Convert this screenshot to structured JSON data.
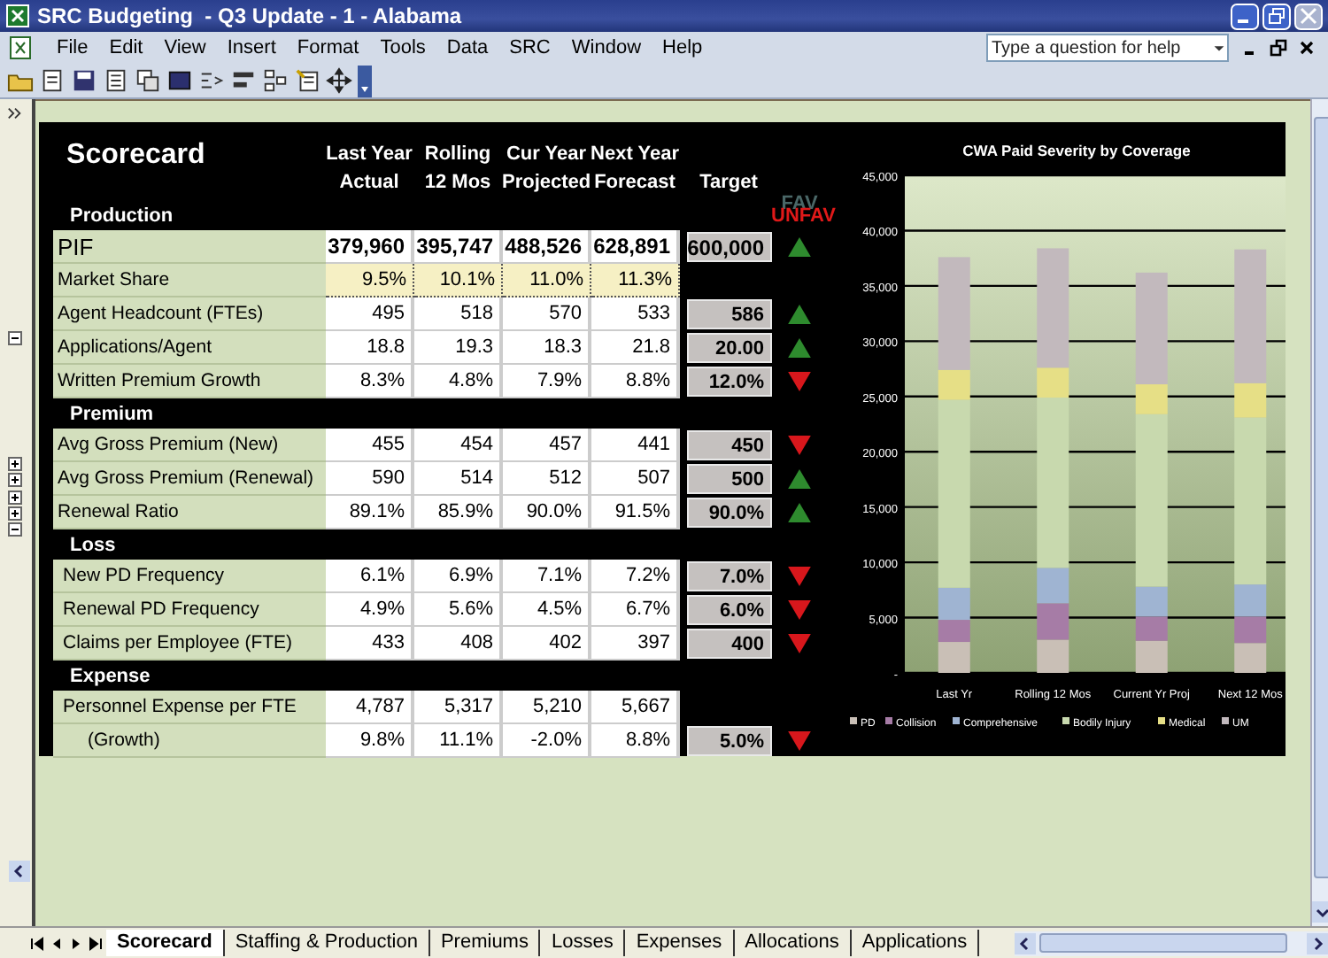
{
  "window": {
    "title": "SRC Budgeting  - Q3 Update - 1 - Alabama"
  },
  "menu": [
    "File",
    "Edit",
    "View",
    "Insert",
    "Format",
    "Tools",
    "Data",
    "SRC",
    "Window",
    "Help"
  ],
  "help": {
    "placeholder": "Type a question for help"
  },
  "scorecard": {
    "title": "Scorecard",
    "columns": [
      "Last Year\nActual",
      "Rolling\n12 Mos",
      "Cur Year\nProjected",
      "Next Year\nForecast",
      "Target"
    ],
    "fav_label": "FAV",
    "unfav_label": "UNFAV",
    "sections": [
      {
        "name": "Production",
        "rows": [
          {
            "label": "PIF",
            "kind": "headline",
            "values": [
              "379,960",
              "395,747",
              "488,526",
              "628,891"
            ],
            "target": "600,000",
            "favorable": true
          },
          {
            "label": "Market Share",
            "kind": "highlight",
            "values": [
              "9.5%",
              "10.1%",
              "11.0%",
              "11.3%"
            ]
          },
          {
            "label": "Agent Headcount (FTEs)",
            "kind": "metric",
            "values": [
              "495",
              "518",
              "570",
              "533"
            ],
            "target": "586",
            "favorable": true
          },
          {
            "label": "Applications/Agent",
            "kind": "metric",
            "values": [
              "18.8",
              "19.3",
              "18.3",
              "21.8"
            ],
            "target": "20.00",
            "favorable": true
          },
          {
            "label": "Written Premium Growth",
            "kind": "metric",
            "values": [
              "8.3%",
              "4.8%",
              "7.9%",
              "8.8%"
            ],
            "target": "12.0%",
            "favorable": false
          }
        ]
      },
      {
        "name": "Premium",
        "rows": [
          {
            "label": "Avg Gross Premium (New)",
            "kind": "metric",
            "values": [
              "455",
              "454",
              "457",
              "441"
            ],
            "target": "450",
            "favorable": false
          },
          {
            "label": "Avg Gross Premium (Renewal)",
            "kind": "metric",
            "values": [
              "590",
              "514",
              "512",
              "507"
            ],
            "target": "500",
            "favorable": true
          },
          {
            "label": "Renewal Ratio",
            "kind": "metric",
            "values": [
              "89.1%",
              "85.9%",
              "90.0%",
              "91.5%"
            ],
            "target": "90.0%",
            "favorable": true
          }
        ]
      },
      {
        "name": "Loss",
        "rows": [
          {
            "label": "New PD Frequency",
            "kind": "metric",
            "values": [
              "6.1%",
              "6.9%",
              "7.1%",
              "7.2%"
            ],
            "target": "7.0%",
            "favorable": false
          },
          {
            "label": "Renewal PD Frequency",
            "kind": "metric",
            "values": [
              "4.9%",
              "5.6%",
              "4.5%",
              "6.7%"
            ],
            "target": "6.0%",
            "favorable": false
          },
          {
            "label": "Claims per Employee (FTE)",
            "kind": "metric",
            "values": [
              "433",
              "408",
              "402",
              "397"
            ],
            "target": "400",
            "favorable": false
          }
        ]
      },
      {
        "name": "Expense",
        "rows": [
          {
            "label": "Personnel Expense per FTE",
            "kind": "metric",
            "values": [
              "4,787",
              "5,317",
              "5,210",
              "5,667"
            ]
          },
          {
            "label": "(Growth)",
            "kind": "sub",
            "values": [
              "9.8%",
              "11.1%",
              "-2.0%",
              "8.8%"
            ],
            "target": "5.0%",
            "favorable": false
          }
        ]
      }
    ]
  },
  "chart": {
    "chart_data": {
      "type": "bar",
      "title": "CWA Paid Severity by Coverage",
      "stacked": true,
      "grid": true,
      "legend": true,
      "categories": [
        "Last Yr",
        "Rolling 12 Mos",
        "Current Yr Proj",
        "Next 12 Mos"
      ],
      "series": [
        {
          "name": "PD",
          "color": "#c9bfb6",
          "values": [
            2800,
            3000,
            2900,
            2700
          ]
        },
        {
          "name": "Collision",
          "color": "#a67ca6",
          "values": [
            2000,
            3300,
            2200,
            2400
          ]
        },
        {
          "name": "Comprehensive",
          "color": "#9fb4d2",
          "values": [
            2900,
            3200,
            2700,
            2900
          ]
        },
        {
          "name": "Bodily Injury",
          "color": "#c8d9ae",
          "values": [
            17000,
            15400,
            15600,
            15100
          ]
        },
        {
          "name": "Medical",
          "color": "#e6df86",
          "values": [
            2700,
            2700,
            2700,
            3100
          ]
        },
        {
          "name": "UM",
          "color": "#c2b9bd",
          "values": [
            10200,
            10800,
            10100,
            12100
          ]
        }
      ],
      "ylim": [
        0,
        45000
      ],
      "yticks": [
        {
          "value": 0,
          "label": "-"
        },
        {
          "value": 5000,
          "label": "5,000"
        },
        {
          "value": 10000,
          "label": "10,000"
        },
        {
          "value": 15000,
          "label": "15,000"
        },
        {
          "value": 20000,
          "label": "20,000"
        },
        {
          "value": 25000,
          "label": "25,000"
        },
        {
          "value": 30000,
          "label": "30,000"
        },
        {
          "value": 35000,
          "label": "35,000"
        },
        {
          "value": 40000,
          "label": "40,000"
        },
        {
          "value": 45000,
          "label": "45,000"
        }
      ]
    }
  },
  "sheet_tabs": [
    {
      "label": "Scorecard",
      "selected": true
    },
    {
      "label": "Staffing & Production",
      "selected": false
    },
    {
      "label": "Premiums",
      "selected": false
    },
    {
      "label": "Losses",
      "selected": false
    },
    {
      "label": "Expenses",
      "selected": false
    },
    {
      "label": "Allocations",
      "selected": false
    },
    {
      "label": "Applications",
      "selected": false
    }
  ]
}
